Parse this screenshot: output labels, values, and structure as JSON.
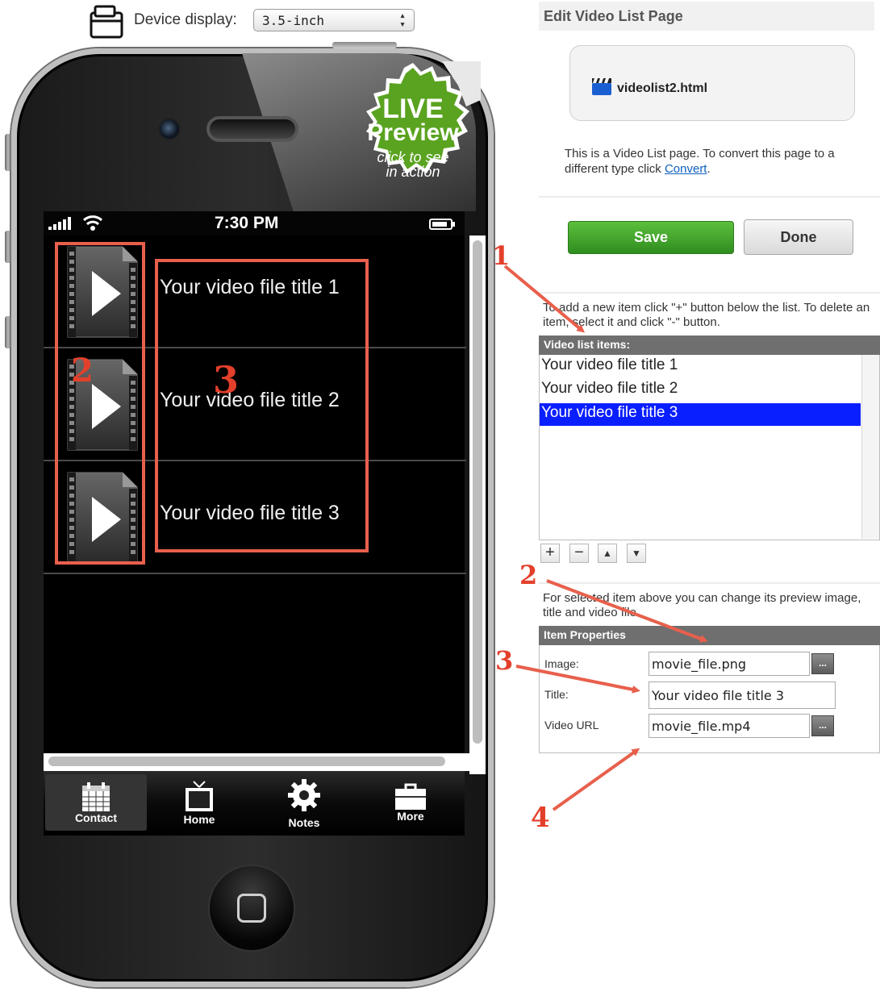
{
  "device_display": {
    "label": "Device display:",
    "selected": "3.5-inch"
  },
  "live_badge": {
    "line1": "LIVE",
    "line2": "Preview",
    "line3a": "click to see",
    "line3b": "in action"
  },
  "phone": {
    "status_time": "7:30 PM",
    "rows": [
      {
        "title": "Your video file title 1"
      },
      {
        "title": "Your video file title 2"
      },
      {
        "title": "Your video file title 3"
      }
    ],
    "tabs": [
      {
        "label": "Contact"
      },
      {
        "label": "Home"
      },
      {
        "label": "Notes"
      },
      {
        "label": "More"
      }
    ]
  },
  "annotations": {
    "n1": "1",
    "n2": "2",
    "n3": "3",
    "n4": "4"
  },
  "panel": {
    "header": "Edit Video List Page",
    "file_name": "videolist2.html",
    "convert_text": "This is a Video List page. To convert this page to a different type click ",
    "convert_link": "Convert",
    "convert_end": ".",
    "save_label": "Save",
    "done_label": "Done",
    "items_help": "To add a new item click \"+\" button below the list. To delete an item, select it and click \"-\" button.",
    "list_header": "Video list items:",
    "list_items": [
      "Your video file title 1",
      "Your video file title 2",
      "Your video file title 3"
    ],
    "tools": {
      "add": "+",
      "remove": "−",
      "up": "▲",
      "down": "▼"
    },
    "props_help": "For selected item above you can change its preview image, title and video file.",
    "props_header": "Item Properties",
    "image_label": "Image:",
    "image_value": "movie_file.png",
    "title_label": "Title:",
    "title_value": "Your video file title 3",
    "video_label": "Video URL",
    "video_value": "movie_file.mp4",
    "browse_label": "..."
  },
  "colors": {
    "save_green": "#3aa02a",
    "selected_blue": "#0a1fff",
    "annotation_red": "#e3402b"
  }
}
